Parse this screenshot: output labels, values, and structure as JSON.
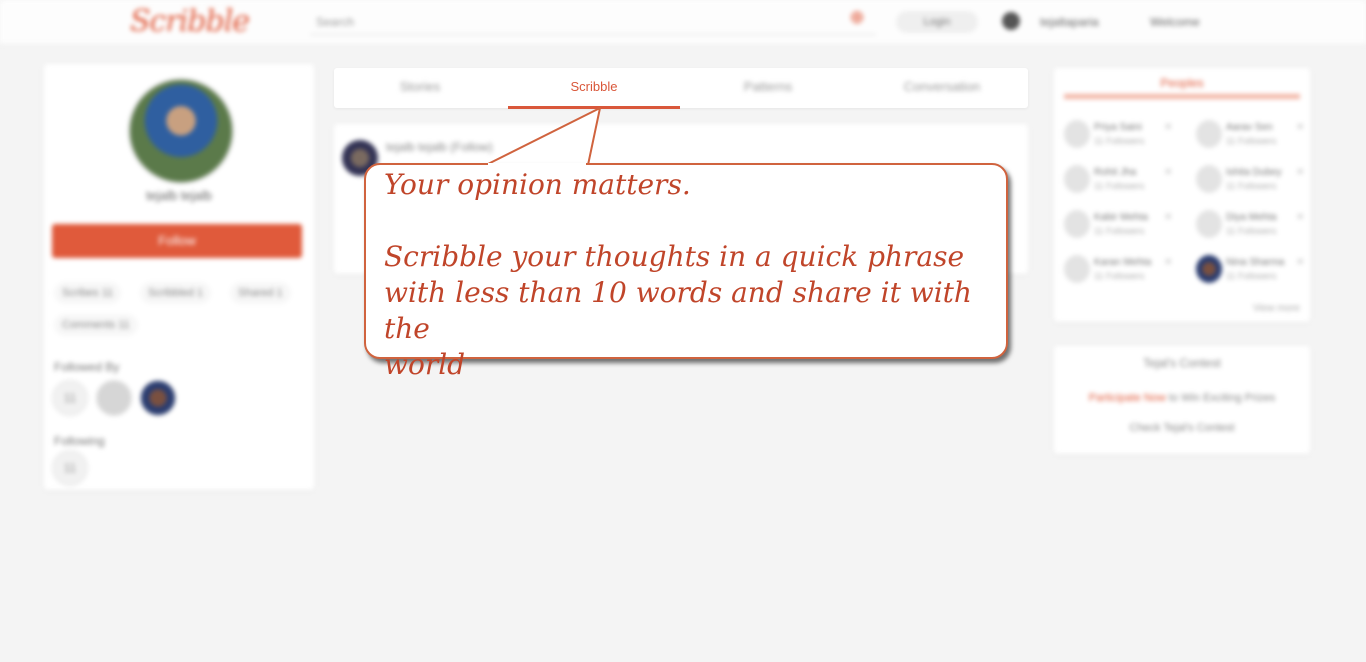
{
  "header": {
    "logo": "Scribble",
    "search_placeholder": "Search",
    "add_icon": "plus-icon",
    "button_label": "Login",
    "user_name": "tejaltaparia",
    "menu_label": "Welcome"
  },
  "profile": {
    "name": "tejalb tejalb",
    "follow_label": "Follow",
    "stats": [
      "Scribes 11",
      "Scribbled 1",
      "Shared 1",
      "Comments 11"
    ],
    "followed_by_label": "Followed By",
    "following_label": "Following",
    "followed_by_count": "11",
    "following_count": "11"
  },
  "tabs": [
    "Stories",
    "Scribble",
    "Patterns",
    "Conversation"
  ],
  "active_tab": "Scribble",
  "post": {
    "author": "tejalb tejalb (Follow)"
  },
  "right_panel": {
    "title": "Peoples",
    "people": [
      {
        "name": "Priya Saini",
        "sub": "11 Followers"
      },
      {
        "name": "Aarav Sen",
        "sub": "11 Followers"
      },
      {
        "name": "Rohit Jha",
        "sub": "11 Followers"
      },
      {
        "name": "Ishita Dubey",
        "sub": "11 Followers"
      },
      {
        "name": "Kabir Mehta",
        "sub": "11 Followers"
      },
      {
        "name": "Diya Mehta",
        "sub": "11 Followers"
      },
      {
        "name": "Karan Mehta",
        "sub": "11 Followers"
      },
      {
        "name": "Nina Sharma",
        "sub": "11 Followers"
      }
    ],
    "view_more": "View more"
  },
  "contest": {
    "title": "Tejal's Contest",
    "highlight": "Participate Now",
    "line_rest": "to Win Exciting Prizes",
    "link": "Check Tejal's Contest"
  },
  "callout": {
    "line1": "Your opinion matters.",
    "line2": "Scribble your thoughts in a quick phrase",
    "line3": "with less than 10 words and share it with the",
    "line4": "world"
  },
  "colors": {
    "accent": "#e05a3b",
    "callout_text": "#c0452a",
    "callout_border": "#d0633e"
  }
}
